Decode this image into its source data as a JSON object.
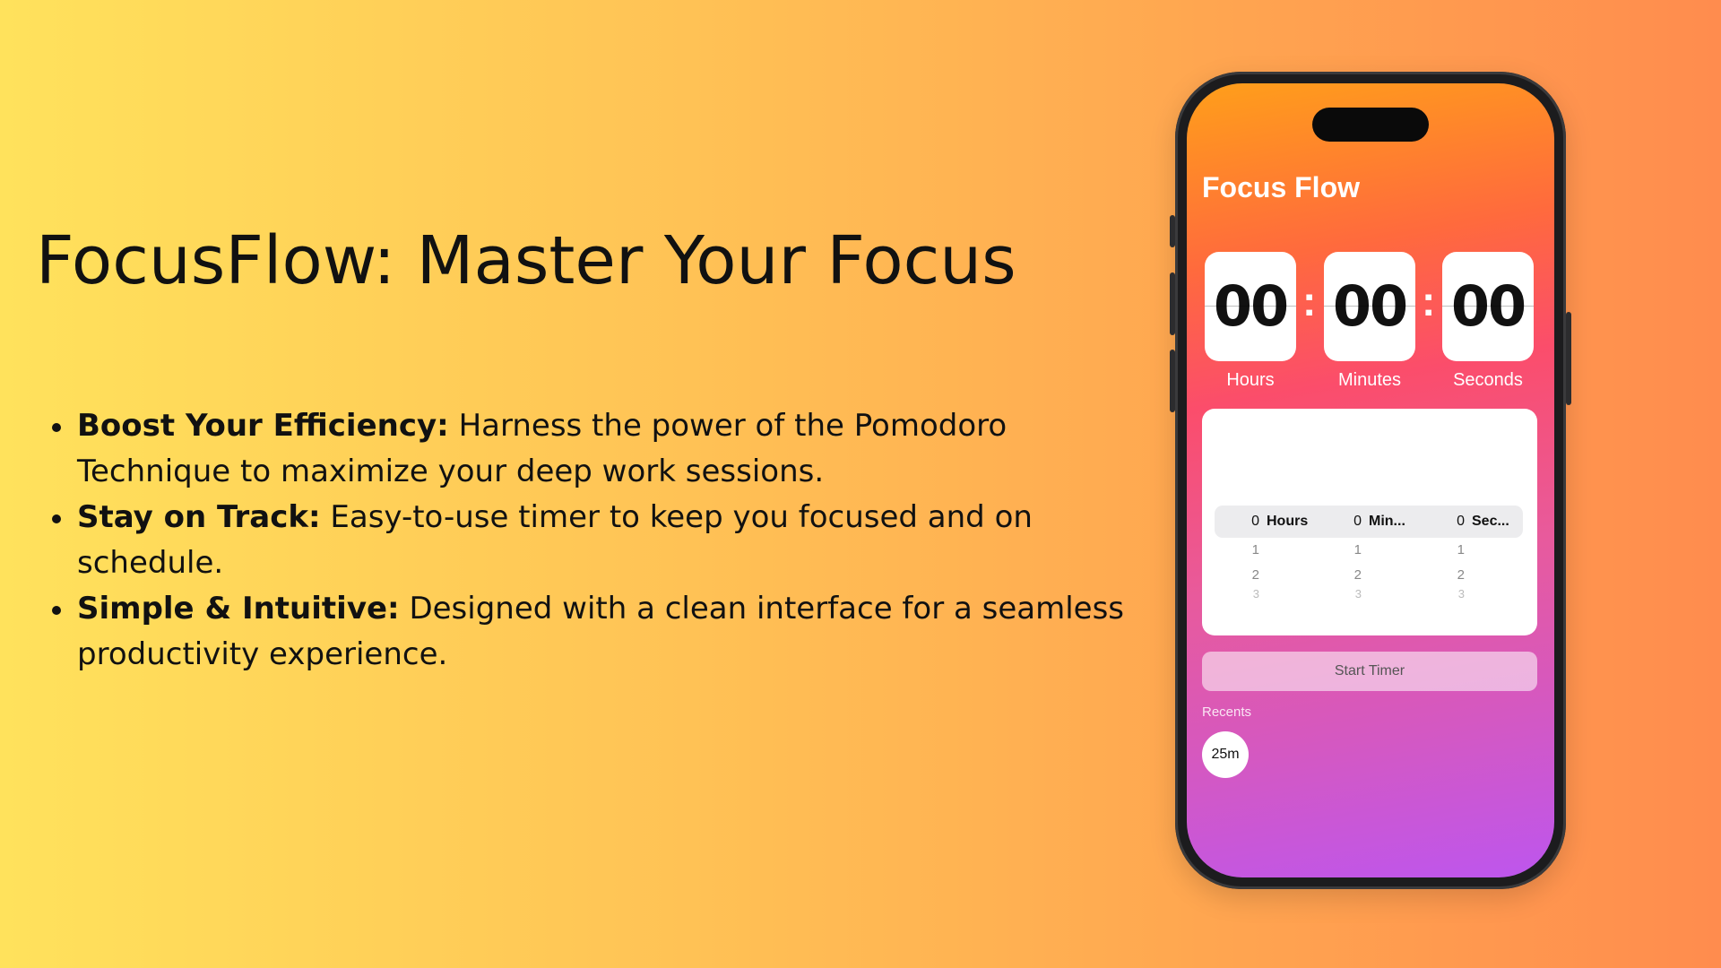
{
  "headline": "FocusFlow: Master Your Focus",
  "bullets": [
    {
      "title": "Boost Your Efficiency:",
      "text": " Harness the power of the Pomodoro Technique to maximize your deep work sessions."
    },
    {
      "title": "Stay on Track:",
      "text": " Easy-to-use timer to keep you focused and on schedule."
    },
    {
      "title": "Simple & Intuitive:",
      "text": " Designed with a clean interface for a seamless productivity experience."
    }
  ],
  "app": {
    "title": "Focus Flow",
    "timer": {
      "hours": "00",
      "minutes": "00",
      "seconds": "00",
      "separator": ":",
      "labels": {
        "hours": "Hours",
        "minutes": "Minutes",
        "seconds": "Seconds"
      }
    },
    "picker": {
      "columns": [
        {
          "selected": "0",
          "label": "Hours",
          "next": [
            "1",
            "2",
            "3"
          ]
        },
        {
          "selected": "0",
          "label": "Min...",
          "next": [
            "1",
            "2",
            "3"
          ]
        },
        {
          "selected": "0",
          "label": "Sec...",
          "next": [
            "1",
            "2",
            "3"
          ]
        }
      ]
    },
    "start_button": "Start Timer",
    "recents_label": "Recents",
    "recents": [
      "25m"
    ]
  },
  "colors": {
    "background_left": "#ffe25c",
    "background_right": "#ff8c4e",
    "screen_top": "#ff9f1a",
    "screen_bottom": "#bd56ee"
  }
}
